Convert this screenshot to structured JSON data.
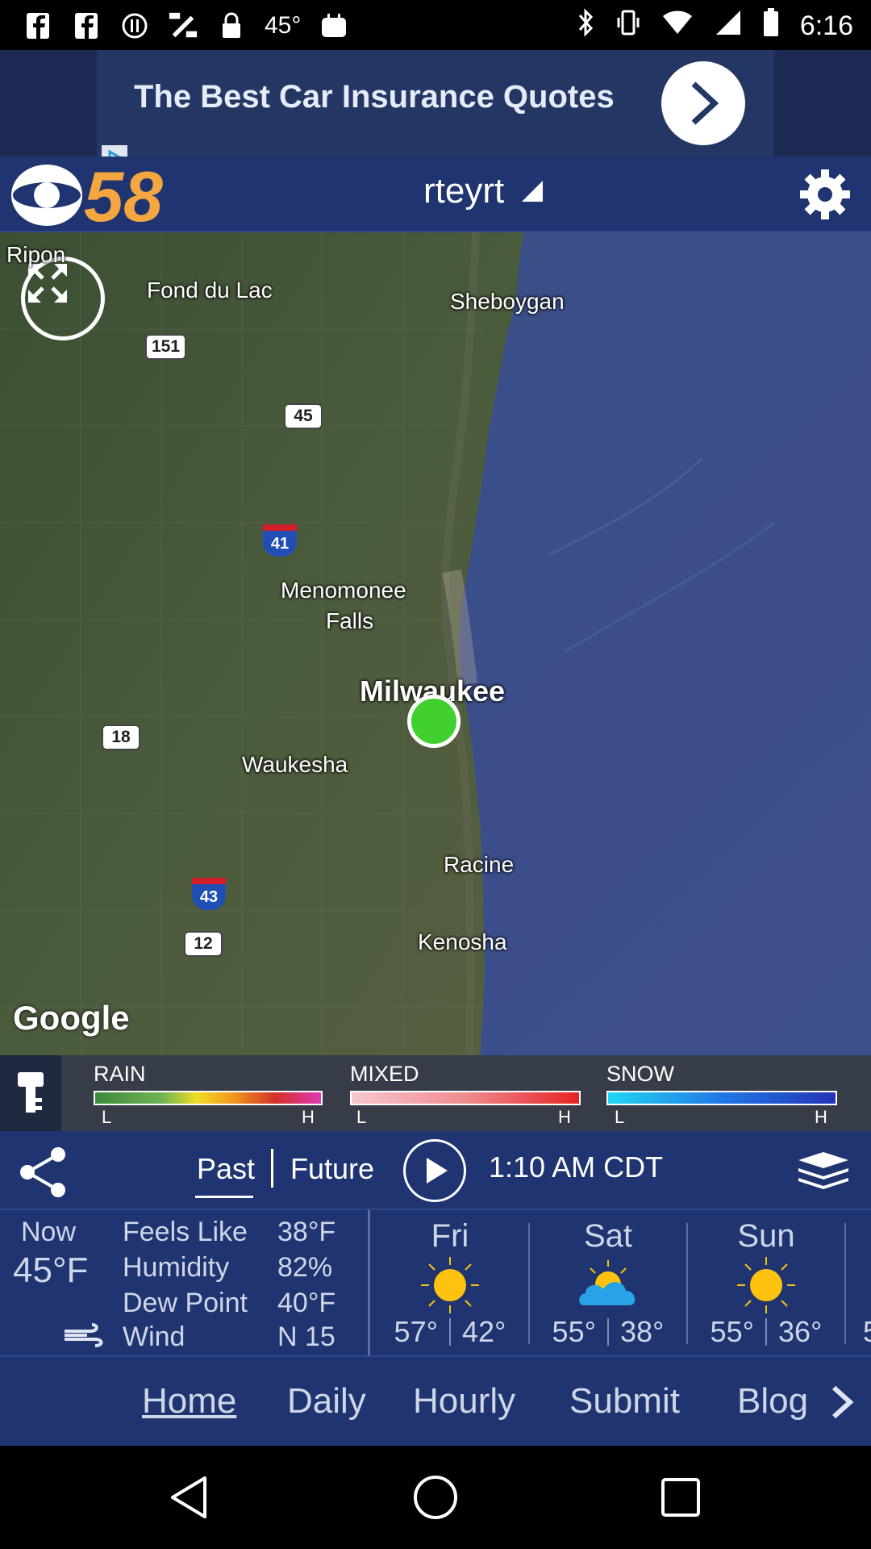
{
  "status_bar": {
    "temp": "45°",
    "time": "6:16",
    "icons": [
      "facebook-icon",
      "facebook-icon",
      "alert-icon",
      "fake-gps-icon",
      "lock-icon",
      "app-icon"
    ]
  },
  "ad": {
    "text": "The Best Car Insurance Quotes"
  },
  "header": {
    "logo_text": "58",
    "location": "rteyrt"
  },
  "map": {
    "labels": {
      "ripon": "Ripon",
      "fond_du_lac": "Fond du Lac",
      "sheboygan": "Sheboygan",
      "menomonee_falls_1": "Menomonee",
      "menomonee_falls_2": "Falls",
      "milwaukee": "Milwaukee",
      "waukesha": "Waukesha",
      "racine": "Racine",
      "kenosha": "Kenosha"
    },
    "shields": {
      "us151": "151",
      "us45": "45",
      "i41": "41",
      "us18": "18",
      "i43": "43",
      "us12": "12"
    },
    "attribution": "Google"
  },
  "legend": {
    "rain": "RAIN",
    "mixed": "MIXED",
    "snow": "SNOW",
    "low": "L",
    "high": "H"
  },
  "controls": {
    "past": "Past",
    "future": "Future",
    "time": "1:10 AM CDT"
  },
  "current": {
    "now_label": "Now",
    "now_temp": "45°F",
    "feels_like_label": "Feels Like",
    "feels_like": "38°F",
    "humidity_label": "Humidity",
    "humidity": "82%",
    "dew_point_label": "Dew Point",
    "dew_point": "40°F",
    "wind_label": "Wind",
    "wind": "N 15"
  },
  "forecast": [
    {
      "day": "Fri",
      "high": "57°",
      "low": "42°",
      "icon": "sun-icon"
    },
    {
      "day": "Sat",
      "high": "55°",
      "low": "38°",
      "icon": "partly-cloudy-icon"
    },
    {
      "day": "Sun",
      "high": "55°",
      "low": "36°",
      "icon": "sun-icon"
    }
  ],
  "forecast_partial": "5",
  "nav": {
    "home": "Home",
    "daily": "Daily",
    "hourly": "Hourly",
    "submit": "Submit",
    "blog": "Blog"
  },
  "colors": {
    "app_blue": "#1f3470",
    "location_dot": "#41d12f",
    "sun": "#ffc20e",
    "cloud": "#29a3e8"
  }
}
